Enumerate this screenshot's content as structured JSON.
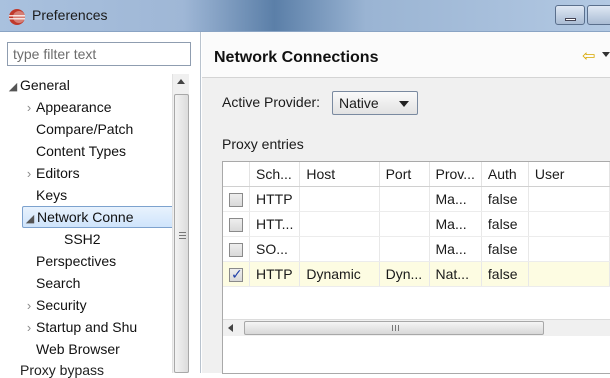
{
  "window": {
    "title": "Preferences"
  },
  "filter": {
    "placeholder": "type filter text"
  },
  "tree": {
    "items": [
      {
        "label": "General",
        "twisty": "open",
        "level": 0
      },
      {
        "label": "Appearance",
        "twisty": "closed",
        "level": 1
      },
      {
        "label": "Compare/Patch",
        "twisty": "none",
        "level": 1
      },
      {
        "label": "Content Types",
        "twisty": "none",
        "level": 1
      },
      {
        "label": "Editors",
        "twisty": "closed",
        "level": 1
      },
      {
        "label": "Keys",
        "twisty": "none",
        "level": 1
      },
      {
        "label": "Network Conne",
        "twisty": "open",
        "level": 1,
        "selected": true
      },
      {
        "label": "SSH2",
        "twisty": "none",
        "level": 2
      },
      {
        "label": "Perspectives",
        "twisty": "none",
        "level": 1
      },
      {
        "label": "Search",
        "twisty": "none",
        "level": 1
      },
      {
        "label": "Security",
        "twisty": "closed",
        "level": 1
      },
      {
        "label": "Startup and Shu",
        "twisty": "closed",
        "level": 1
      },
      {
        "label": "Web Browser",
        "twisty": "none",
        "level": 1
      }
    ]
  },
  "page": {
    "title": "Network Connections",
    "provider_label": "Active Provider:",
    "provider_value": "Native",
    "proxy_entries_label": "Proxy entries",
    "proxy_bypass_label": "Proxy bypass"
  },
  "table": {
    "columns": [
      "",
      "Sch...",
      "Host",
      "Port",
      "Prov...",
      "Auth",
      "User"
    ],
    "rows": [
      {
        "checked": false,
        "scheme": "HTTP",
        "host": "",
        "port": "",
        "provider": "Ma...",
        "auth": "false",
        "user": ""
      },
      {
        "checked": false,
        "scheme": "HTT...",
        "host": "",
        "port": "",
        "provider": "Ma...",
        "auth": "false",
        "user": ""
      },
      {
        "checked": false,
        "scheme": "SO...",
        "host": "",
        "port": "",
        "provider": "Ma...",
        "auth": "false",
        "user": ""
      },
      {
        "checked": true,
        "scheme": "HTTP",
        "host": "Dynamic",
        "port": "Dyn...",
        "provider": "Nat...",
        "auth": "false",
        "user": "",
        "highlighted": true
      }
    ]
  },
  "colors": {
    "selection": "#cfe4fb",
    "highlight_row": "#fdfce2",
    "accent_arrow": "#d8a800"
  }
}
